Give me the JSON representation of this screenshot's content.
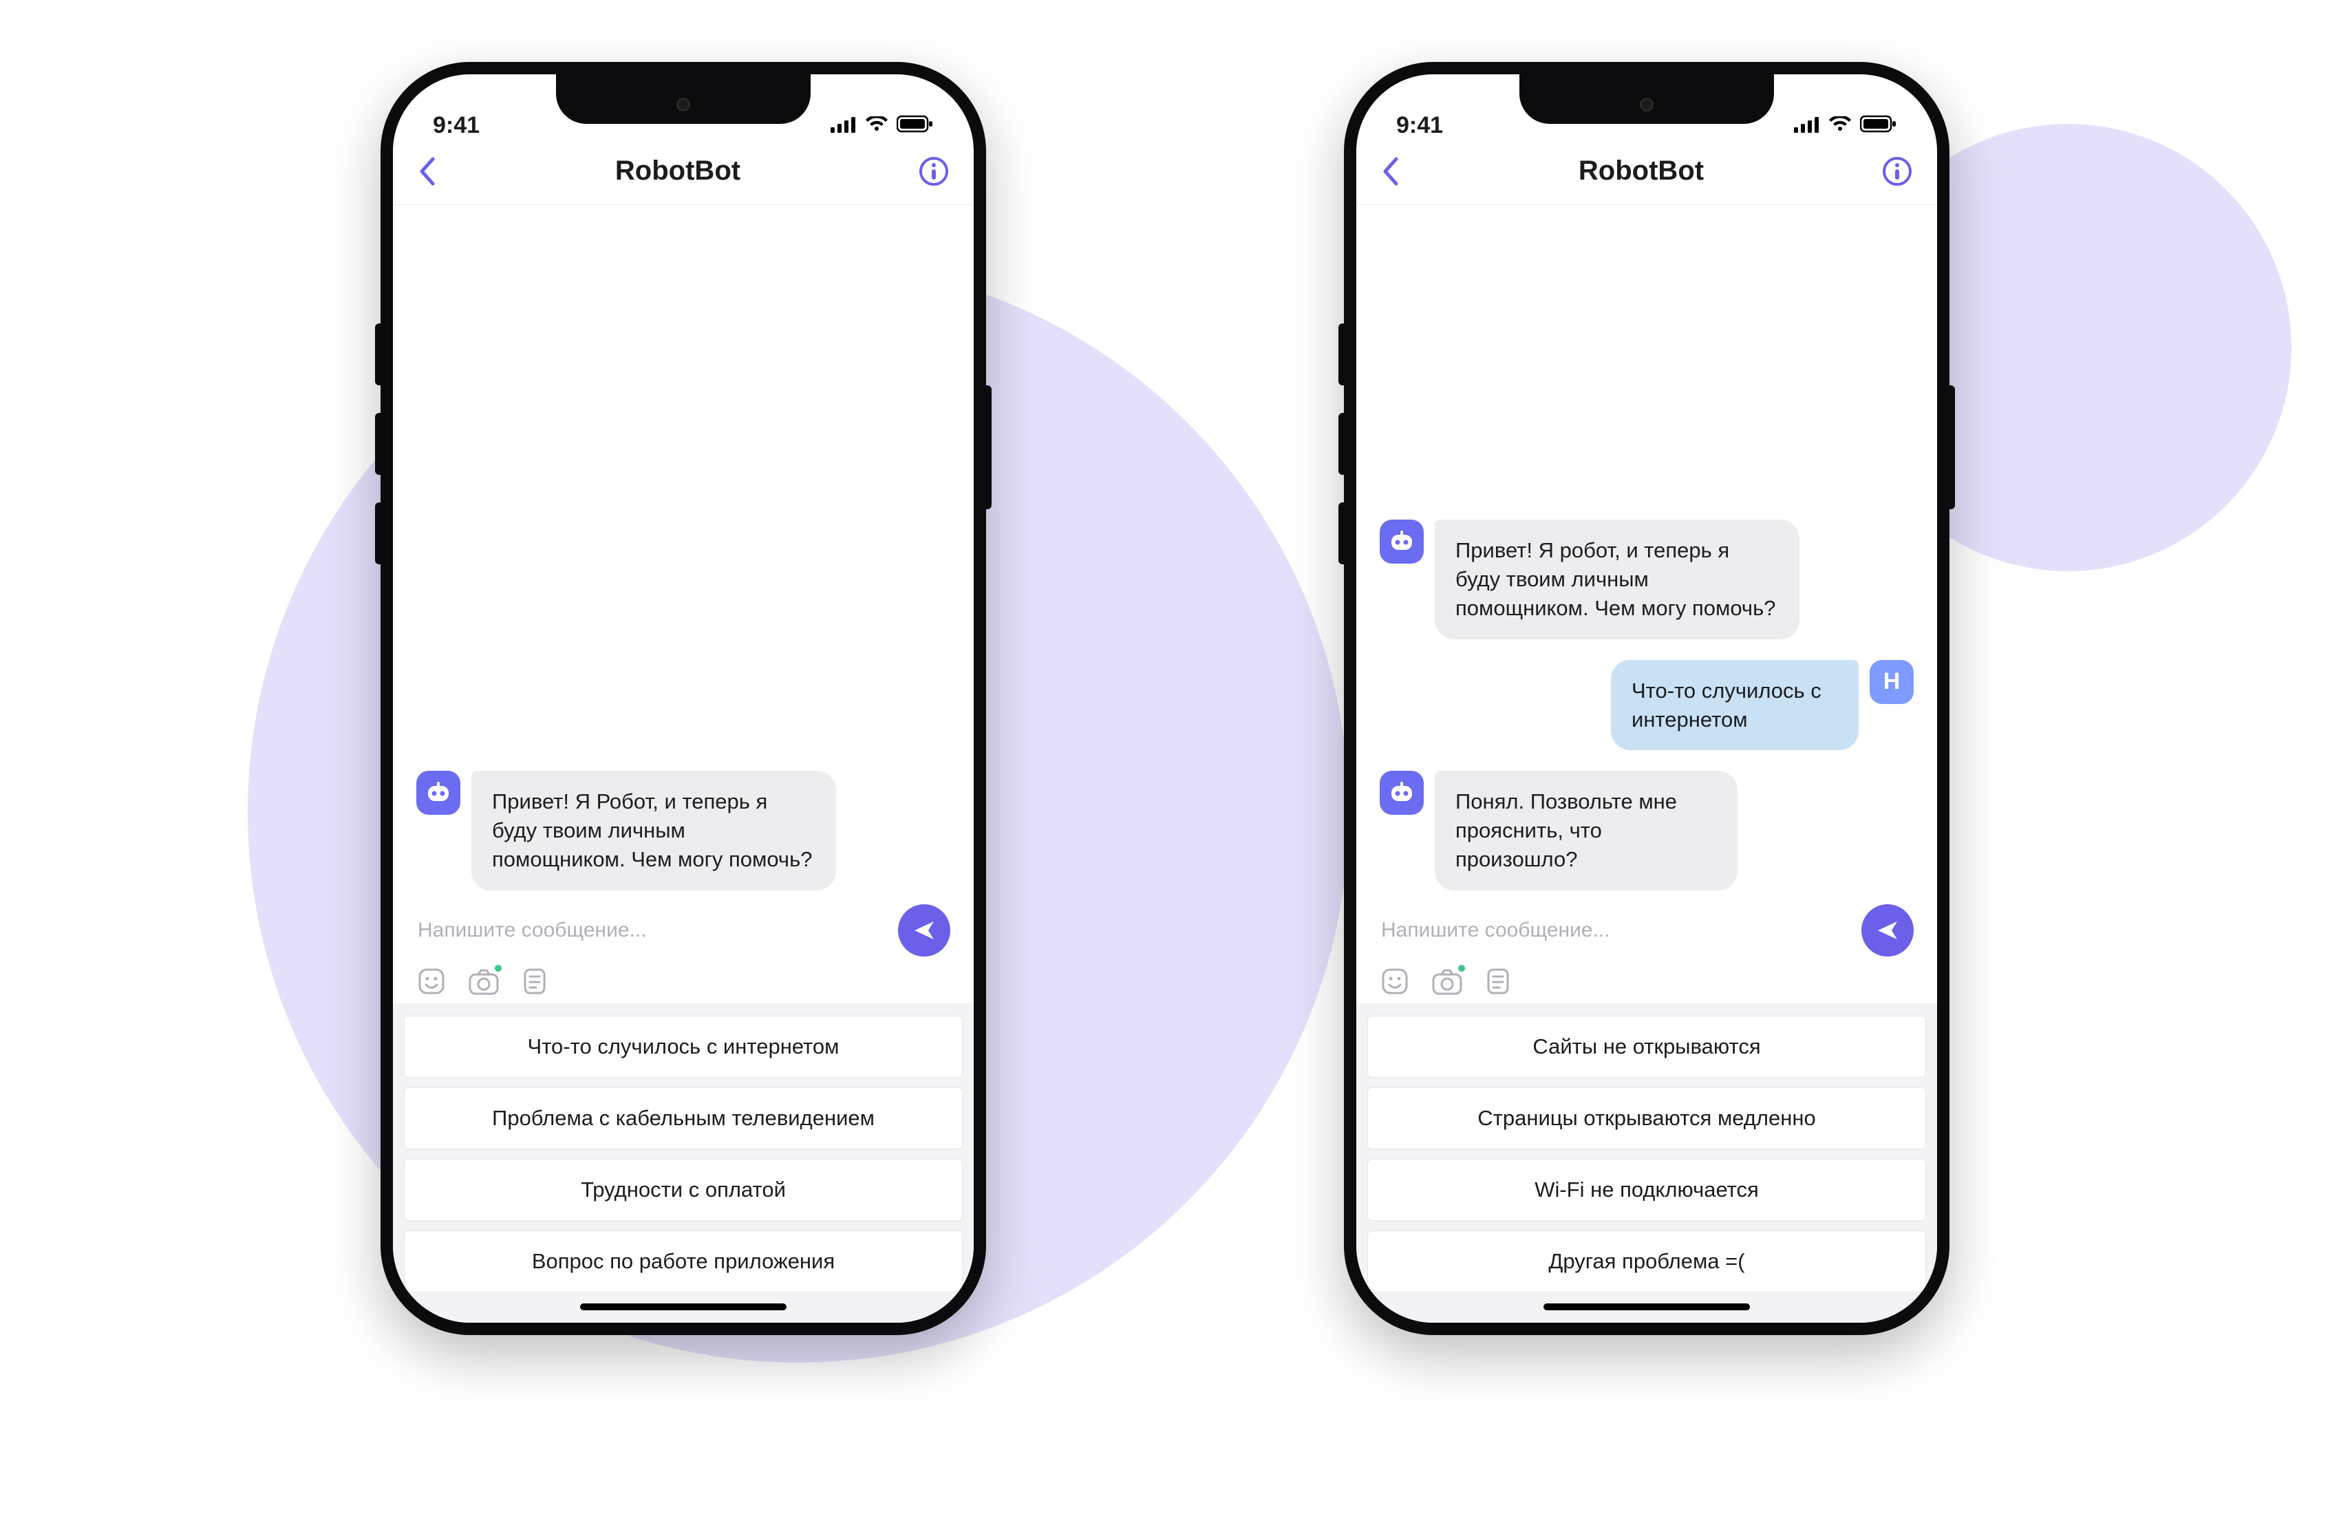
{
  "status_time": "9:41",
  "user_avatar_letter": "Н",
  "phones": [
    {
      "header_title": "RobotBot",
      "input_placeholder": "Напишите сообщение...",
      "messages": [
        {
          "from": "bot",
          "text": "Привет! Я Робот, и теперь я буду твоим личным помощником. Чем могу помочь?"
        }
      ],
      "quick_replies": [
        "Что-то случилось с интернетом",
        "Проблема с кабельным телевидением",
        "Трудности с оплатой",
        "Вопрос по работе приложения"
      ]
    },
    {
      "header_title": "RobotBot",
      "input_placeholder": "Напишите сообщение...",
      "messages": [
        {
          "from": "bot",
          "text": "Привет! Я робот, и теперь я буду твоим личным помощником. Чем могу помочь?"
        },
        {
          "from": "user",
          "text": "Что-то случилось с интернетом"
        },
        {
          "from": "bot",
          "text": "Понял. Позвольте мне прояснить, что произошло?"
        }
      ],
      "quick_replies": [
        "Сайты не открываются",
        "Страницы открываются медленно",
        "Wi-Fi не подключается",
        "Другая проблема =("
      ]
    }
  ]
}
